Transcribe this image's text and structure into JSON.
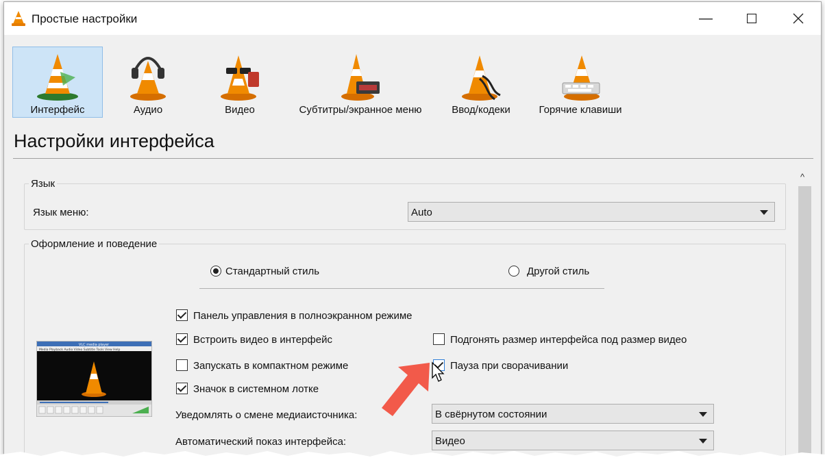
{
  "window": {
    "title": "Простые настройки"
  },
  "toolbar": {
    "items": [
      {
        "label": "Интерфейс",
        "icon": "vlc-cone-interface-icon"
      },
      {
        "label": "Аудио",
        "icon": "vlc-cone-headphones-icon"
      },
      {
        "label": "Видео",
        "icon": "vlc-cone-glasses-icon"
      },
      {
        "label": "Субтитры/экранное меню",
        "icon": "vlc-cone-subtitles-icon"
      },
      {
        "label": "Ввод/кодеки",
        "icon": "vlc-cone-cables-icon"
      },
      {
        "label": "Горячие клавиши",
        "icon": "vlc-cone-keyboard-icon"
      }
    ]
  },
  "page": {
    "title": "Настройки интерфейса"
  },
  "language": {
    "group_title": "Язык",
    "menu_language_label": "Язык меню:",
    "menu_language_value": "Auto"
  },
  "look": {
    "group_title": "Оформление и поведение",
    "radio_standard": "Стандартный стиль",
    "radio_other": "Другой стиль",
    "cb_fullscreen_controller": "Панель управления в полноэкранном режиме",
    "cb_embed_video": "Встроить видео в интерфейс",
    "cb_resize_to_video": "Подгонять размер интерфейса под размер видео",
    "cb_minimal_mode": "Запускать в компактном режиме",
    "cb_pause_minimized": "Пауза при сворачивании",
    "cb_systray": "Значок в системном лотке",
    "notify_label": "Уведомлять о смене медиаисточника:",
    "notify_value": "В свёрнутом состоянии",
    "auto_raise_label": "Автоматический показ интерфейса:",
    "auto_raise_value": "Видео"
  },
  "preview": {
    "window_title": "VLC media player",
    "menu": "Media  Playback  Audio  Video  Subtitle  Tools  View  Help"
  },
  "colors": {
    "accent_selection": "#cde4f7",
    "cone_orange": "#f08a00",
    "annotation_arrow": "#f25a4a"
  }
}
